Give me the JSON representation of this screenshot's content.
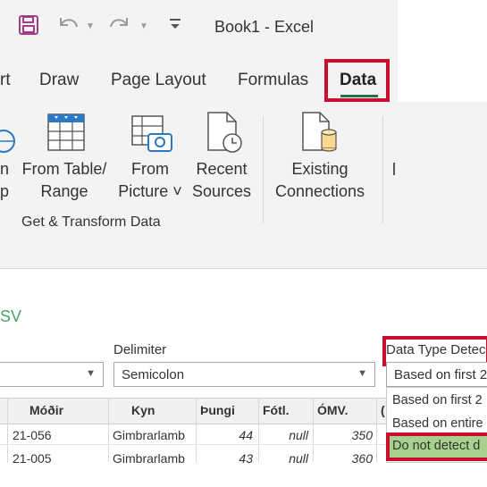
{
  "titlebar": {
    "title": "Book1  -  Excel",
    "qat_dropdown": "Ɑ"
  },
  "tabs": {
    "partial": "rt",
    "draw": "Draw",
    "page_layout": "Page Layout",
    "formulas": "Formulas",
    "data": "Data"
  },
  "ribbon": {
    "partial_left": {
      "line1": "n",
      "line2": "p"
    },
    "from_table": {
      "line1": "From Table/",
      "line2": "Range"
    },
    "from_picture": {
      "line1": "From",
      "line2": "Picture ˅"
    },
    "recent_sources": {
      "line1": "Recent",
      "line2": "Sources"
    },
    "existing_connections": {
      "line1": "Existing",
      "line2": "Connections"
    },
    "group_label": "Get & Transform Data"
  },
  "dialog": {
    "partial_title": "SV",
    "delimiter_label": "Delimiter",
    "delimiter_value": "Semicolon",
    "detect_label": "Data Type Detec",
    "detect_value": "Based on first 2",
    "options": [
      "Based on first 2",
      "Based on entire",
      "Do not detect d"
    ]
  },
  "table": {
    "headers": [
      "Móðir",
      "Kyn",
      "Þungi",
      "Fótl.",
      "ÓMV.",
      "("
    ],
    "rows": [
      [
        "21-056",
        "Gimbrarlamb",
        "44",
        "null",
        "350"
      ],
      [
        "21-005",
        "Gimbrarlamb",
        "43",
        "null",
        "360"
      ]
    ]
  },
  "colors": {
    "accent": "#217346",
    "highlight": "#c8102e",
    "selected": "#a9d18e"
  }
}
